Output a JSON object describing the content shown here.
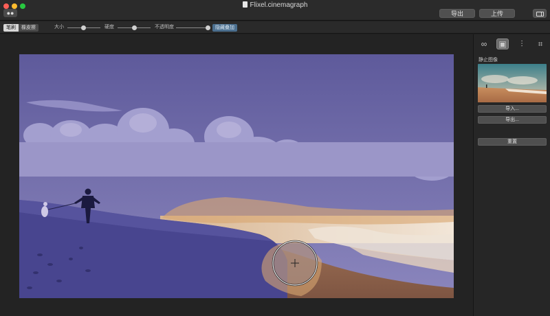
{
  "window": {
    "title": "Flixel.cinemagraph"
  },
  "titlebar": {
    "export_label": "导出",
    "upload_label": "上传"
  },
  "toolbar": {
    "brush_label": "笔刷",
    "eraser_label": "橡皮擦",
    "size_label": "大小",
    "hardness_label": "硬度",
    "opacity_label": "不透明度",
    "hide_overlay_label": "隐藏叠加",
    "size_value": 0.48,
    "hardness_value": 0.5,
    "opacity_value": 0.96
  },
  "inspector": {
    "tabs": [
      {
        "icon": "loop-icon",
        "glyph": "∞",
        "active": false
      },
      {
        "icon": "image-icon",
        "glyph": "▣",
        "active": true
      },
      {
        "icon": "adjustments-icon",
        "glyph": "⫶",
        "active": false
      },
      {
        "icon": "crop-icon",
        "glyph": "⌗",
        "active": false
      }
    ],
    "section_title": "静止图像",
    "import_label": "导入...",
    "export_label": "导出...",
    "reset_label": "重置"
  },
  "colors": {
    "mask_overlay": "#6f67b0",
    "brush_stroke": "#d9a671",
    "accent_button": "#4b6f8f"
  }
}
